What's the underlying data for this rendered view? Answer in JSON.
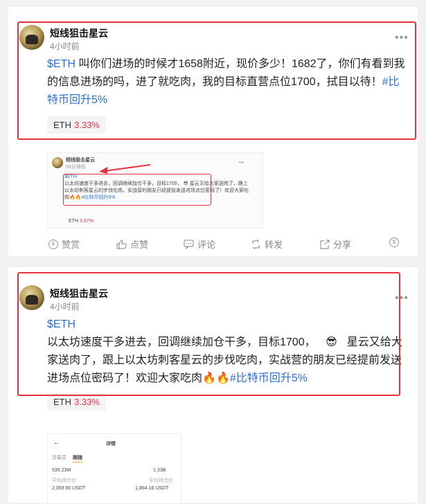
{
  "post1": {
    "username": "短线狙击星云",
    "time": "4小时前",
    "more": "•••",
    "ticker": "$ETH",
    "text": " 叫你们进场的时候才1658附近，现价多少！1682了，你们有看到我的信息进场的吗，进了就吃肉，我的目标直营点位1700，拭目以待！",
    "hashtag": "#比特币回升5%",
    "coin": "ETH",
    "change": "3.33%",
    "thumbnail": {
      "username": "短线狙击星云",
      "time": "58分钟前",
      "more": "•••",
      "ticker": "$ETH",
      "text": "以太坊速度干多进去，回调继续加仓干多，目标1700， 😎  星云又给大家送肉了，跟上以太坊刺客星云的步伐吃肉，实战营的朋友已经提前发送进场点位密码了！欢迎大家吃肉🔥🔥",
      "hashtag": "#比特币回升5%",
      "coin": "ETH",
      "change": "3.97%"
    },
    "actions": {
      "reward": "赞赏",
      "like": "点赞",
      "comment": "评论",
      "repost": "转发",
      "share": "分享",
      "tip": "$"
    }
  },
  "post2": {
    "username": "短线狙击星云",
    "time": "4小时前",
    "more": "•••",
    "ticker": "$ETH",
    "text_a": "以太坊速度干多进去，回调继续加仓干多，目标1700，",
    "emoji_cool": "😎",
    "text_b": "星云又给大家送肉了，跟上以太坊刺客星云的步伐吃肉，实战营的朋友已经提前发送进场点位密码了！欢迎大家吃肉",
    "fire": "🔥🔥",
    "hashtag": "#比特币回升5%",
    "coin": "ETH",
    "change": "3.33%",
    "screenshot": {
      "back": "←",
      "title": "详情",
      "tab1": "交易员",
      "tab2": "跟随",
      "v1": "535.23M",
      "v2": "1.33B",
      "l1": "平均持仓价",
      "l2": "平均持仓价",
      "p1": "2,059.90 USDT",
      "p2": "1,864.16 USDT"
    }
  }
}
